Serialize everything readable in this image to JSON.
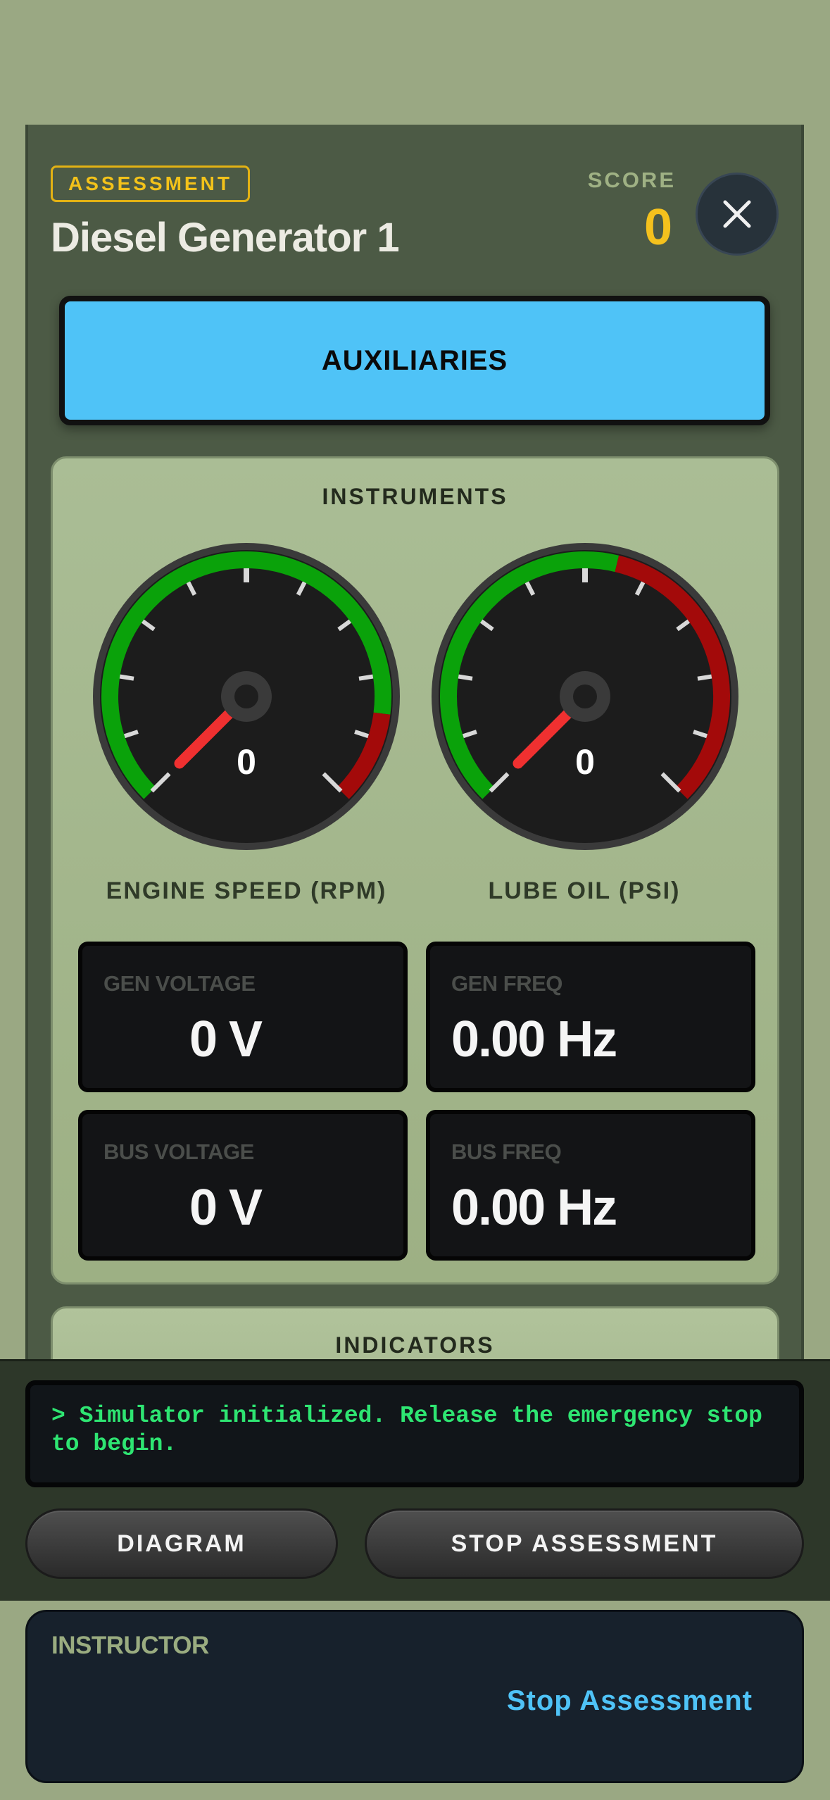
{
  "header": {
    "badge": "ASSESSMENT",
    "title": "Diesel Generator 1",
    "score_label": "SCORE",
    "score_value": "0",
    "close_icon": "close-icon"
  },
  "colors": {
    "accent_blue": "#4fc3f7",
    "badge_yellow": "#f3c21a",
    "gauge_green": "#0aa20a",
    "gauge_red": "#a30a0a",
    "console_green": "#2ee572"
  },
  "aux_button": {
    "label": "AUXILIARIES"
  },
  "instruments": {
    "title": "INSTRUMENTS",
    "gauges": [
      {
        "label": "ENGINE SPEED (RPM)",
        "value": "0",
        "green_fraction": 0.86
      },
      {
        "label": "LUBE OIL (PSI)",
        "value": "0",
        "green_fraction": 0.55
      }
    ],
    "readouts": [
      {
        "label": "GEN VOLTAGE",
        "value": "0 V"
      },
      {
        "label": "GEN FREQ",
        "value": "0.00 Hz"
      },
      {
        "label": "BUS VOLTAGE",
        "value": "0 V"
      },
      {
        "label": "BUS FREQ",
        "value": "0.00 Hz"
      }
    ]
  },
  "indicators": {
    "title": "INDICATORS"
  },
  "console": {
    "text": "> Simulator initialized. Release the emergency stop to begin."
  },
  "controls": {
    "diagram_label": "DIAGRAM",
    "stop_label": "STOP ASSESSMENT"
  },
  "instructor": {
    "label": "INSTRUCTOR",
    "button_label": "Stop Assessment"
  }
}
